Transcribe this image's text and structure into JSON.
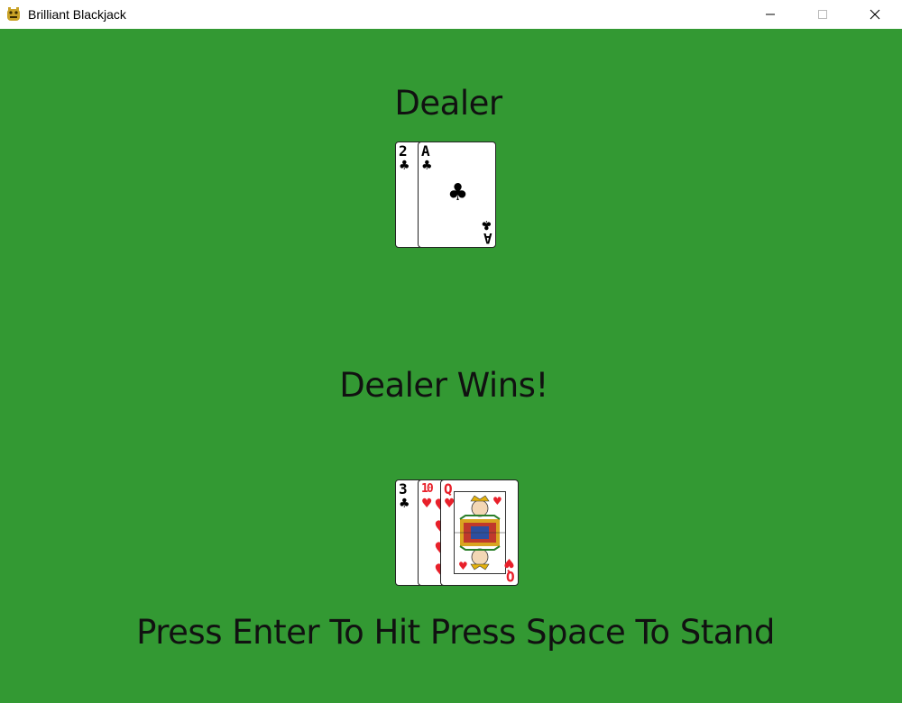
{
  "window": {
    "title": "Brilliant Blackjack",
    "icon": "pygame-snake-icon",
    "buttons": [
      "minimize",
      "maximize",
      "close"
    ]
  },
  "colors": {
    "table": "#339933",
    "text": "#111111",
    "red_suit": "#e8202a",
    "black_suit": "#000000"
  },
  "dealer": {
    "label": "Dealer",
    "cards": [
      {
        "rank": "2",
        "suit": "♣",
        "color": "black"
      },
      {
        "rank": "A",
        "suit": "♣",
        "color": "black"
      }
    ]
  },
  "result": "Dealer Wins!",
  "player": {
    "cards": [
      {
        "rank": "3",
        "suit": "♣",
        "color": "black"
      },
      {
        "rank": "10",
        "suit": "♥",
        "color": "red"
      },
      {
        "rank": "Q",
        "suit": "♥",
        "color": "red"
      }
    ]
  },
  "prompt": "Press Enter To Hit Press Space To Stand"
}
